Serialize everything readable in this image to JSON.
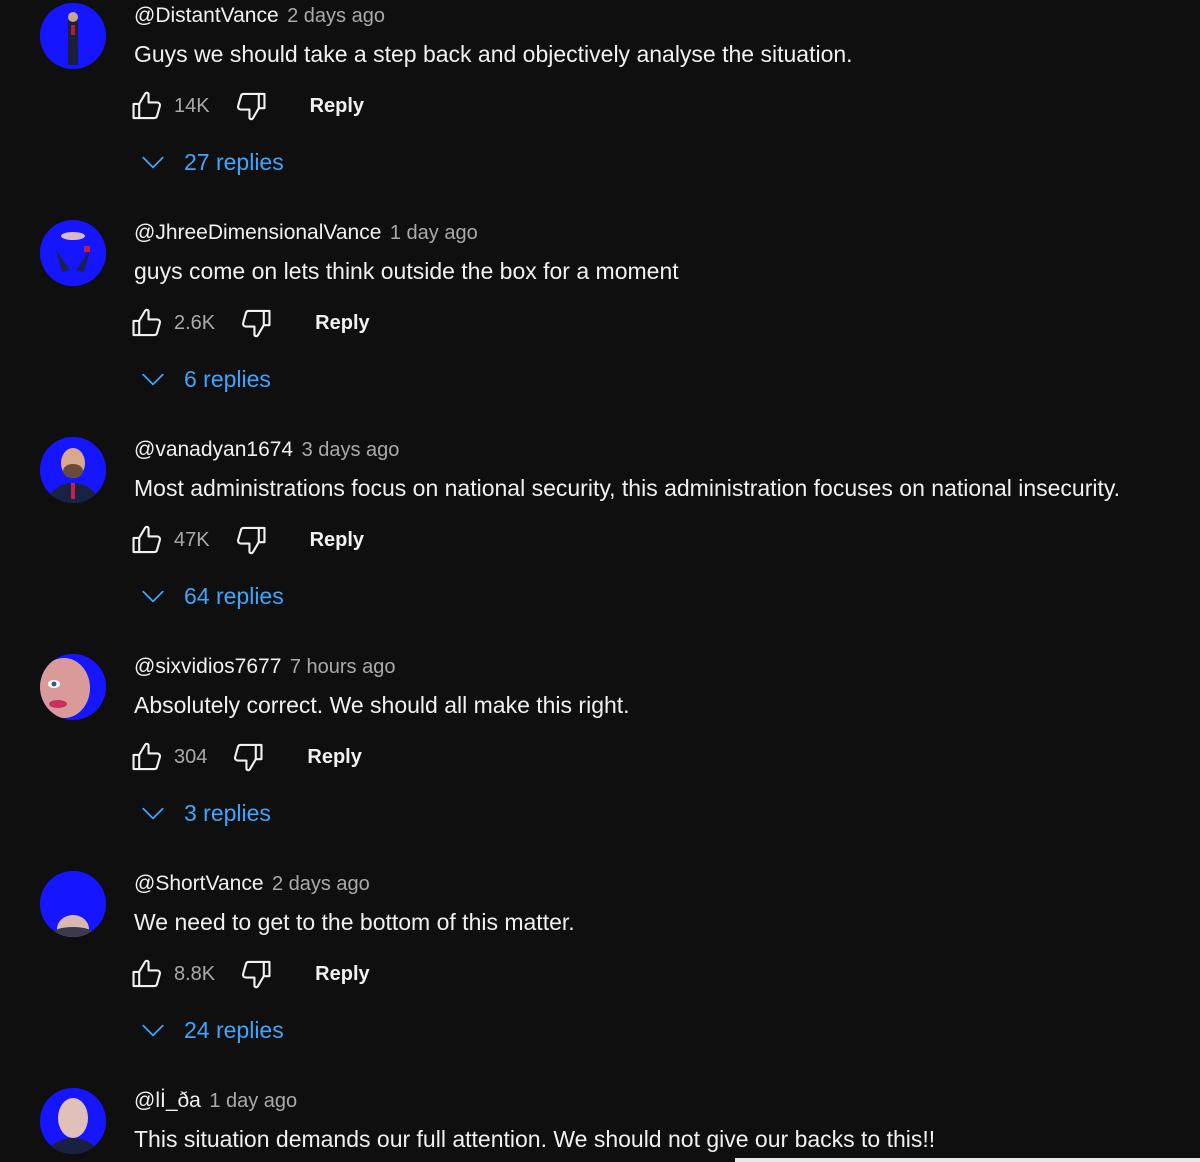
{
  "comments": [
    {
      "author": "@DistantVance",
      "time": "2 days ago",
      "text": "Guys we should take a step back and objectively analyse the situation.",
      "likes": "14K",
      "reply_label": "Reply",
      "replies": "27 replies"
    },
    {
      "author": "@JhreeDimensionalVance",
      "time": "1 day ago",
      "text": "guys come on lets think outside the box for a moment",
      "likes": "2.6K",
      "reply_label": "Reply",
      "replies": "6 replies"
    },
    {
      "author": "@vanadyan1674",
      "time": "3 days ago",
      "text": "Most administrations focus on national security, this administration focuses on national insecurity.",
      "likes": "47K",
      "reply_label": "Reply",
      "replies": "64 replies"
    },
    {
      "author": "@sixvidios7677",
      "time": "7 hours ago",
      "text": "Absolutely correct. We should all make this right.",
      "likes": "304",
      "reply_label": "Reply",
      "replies": "3 replies"
    },
    {
      "author": "@ShortVance",
      "time": "2 days ago",
      "text": "We need to get to the bottom of this matter.",
      "likes": "8.8K",
      "reply_label": "Reply",
      "replies": "24 replies"
    },
    {
      "author": "@lİ_ða",
      "time": "1 day ago",
      "text": "This situation demands our full attention. We should not give our backs to this!!"
    }
  ],
  "colors": {
    "background": "#0f0f0f",
    "text": "#f1f1f1",
    "secondary_text": "#aaaaaa",
    "link": "#3ea6ff",
    "avatar_background": "#1515ff"
  },
  "icons": {
    "like": "thumbs-up-icon",
    "dislike": "thumbs-down-icon",
    "expand": "chevron-down-icon"
  }
}
